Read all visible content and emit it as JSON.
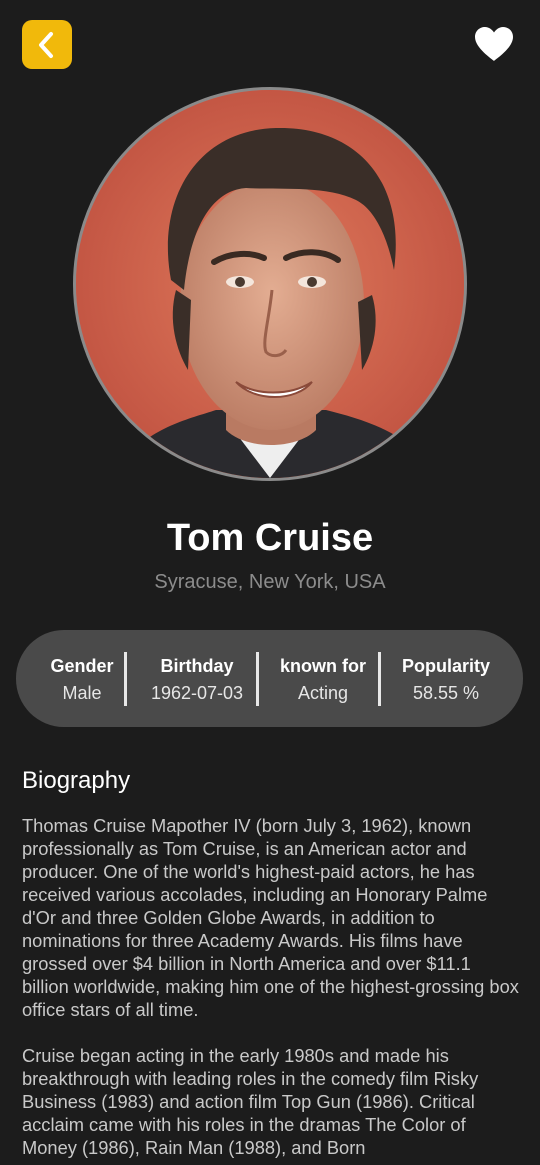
{
  "header": {
    "back_icon": "chevron-left-icon",
    "back_button_color": "#f1b90b",
    "favorite_icon": "heart-icon"
  },
  "profile": {
    "name": "Tom Cruise",
    "place_of_birth": "Syracuse, New York, USA"
  },
  "stats": [
    {
      "label": "Gender",
      "value": "Male"
    },
    {
      "label": "Birthday",
      "value": "1962-07-03"
    },
    {
      "label": "known for",
      "value": "Acting"
    },
    {
      "label": "Popularity",
      "value": "58.55 %"
    }
  ],
  "biography": {
    "title": "Biography",
    "paragraph1": "Thomas Cruise Mapother IV (born July 3, 1962), known professionally as Tom Cruise, is an American actor and producer. One of the world's highest-paid actors, he has received various accolades, including an Honorary Palme d'Or and three Golden Globe Awards, in addition to nominations for three Academy Awards. His films have grossed over $4 billion in North America and over $11.1 billion worldwide, making him one of the highest-grossing box office stars of all time.",
    "paragraph2": "Cruise began acting in the early 1980s and made his breakthrough with leading roles in the comedy film Risky Business (1983) and action film Top Gun (1986). Critical acclaim came with his roles in the dramas The Color of Money (1986), Rain Man (1988), and Born"
  },
  "colors": {
    "background": "#1c1c1c",
    "stats_background": "#4a4a4a",
    "secondary_text": "#8c8c8c"
  }
}
